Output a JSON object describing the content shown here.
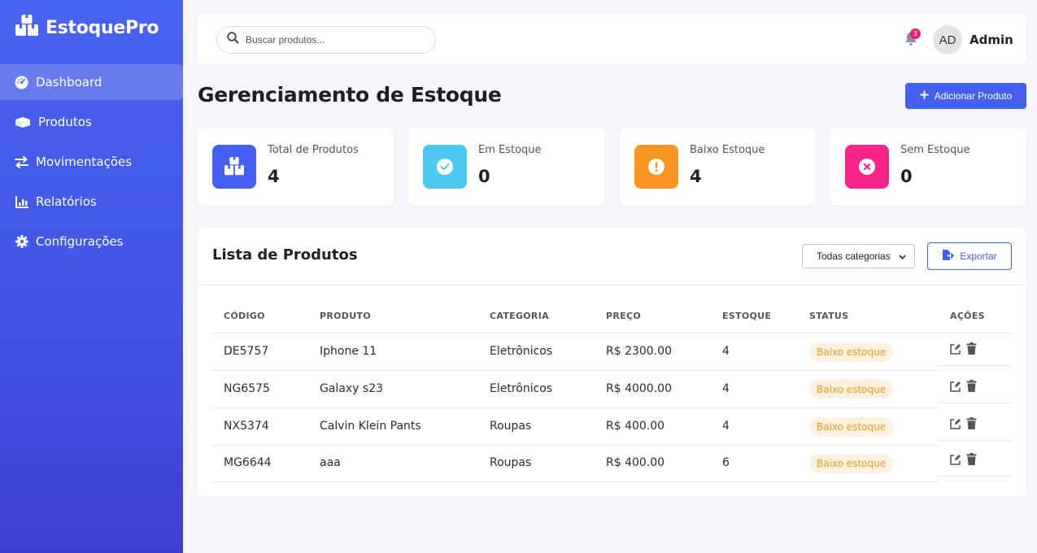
{
  "brand": {
    "name": "EstoquePro"
  },
  "sidebar": {
    "items": [
      {
        "label": "Dashboard",
        "icon": "dashboard-icon",
        "active": true
      },
      {
        "label": "Produtos",
        "icon": "boxes-icon"
      },
      {
        "label": "Movimentações",
        "icon": "exchange-icon"
      },
      {
        "label": "Relatórios",
        "icon": "chart-icon"
      },
      {
        "label": "Configurações",
        "icon": "gear-icon"
      }
    ]
  },
  "topbar": {
    "search_placeholder": "Buscar produtos...",
    "notification_count": "3",
    "avatar_initials": "AD",
    "user_name": "Admin"
  },
  "header": {
    "title": "Gerenciamento de Estoque",
    "add_button": "Adicionar Produto"
  },
  "cards": [
    {
      "label": "Total de Produtos",
      "value": "4",
      "color": "#4361ee",
      "icon": "boxes-icon"
    },
    {
      "label": "Em Estoque",
      "value": "0",
      "color": "#4cc9f0",
      "icon": "check-circle-icon"
    },
    {
      "label": "Baixo Estoque",
      "value": "4",
      "color": "#f8961e",
      "icon": "exclamation-circle-icon"
    },
    {
      "label": "Sem Estoque",
      "value": "0",
      "color": "#f72585",
      "icon": "times-circle-icon"
    }
  ],
  "product_list": {
    "title": "Lista de Produtos",
    "category_filter": "Todas categorias",
    "export_button": "Exportar",
    "columns": [
      "CÓDIGO",
      "PRODUTO",
      "CATEGORIA",
      "PREÇO",
      "ESTOQUE",
      "STATUS",
      "AÇÕES"
    ],
    "rows": [
      {
        "code": "DE5757",
        "product": "Iphone 11",
        "category": "Eletrônicos",
        "price": "R$ 2300.00",
        "stock": "4",
        "status": "Baixo estoque"
      },
      {
        "code": "NG6575",
        "product": "Galaxy s23",
        "category": "Eletrônicos",
        "price": "R$ 4000.00",
        "stock": "4",
        "status": "Baixo estoque"
      },
      {
        "code": "NX5374",
        "product": "Calvin Klein Pants",
        "category": "Roupas",
        "price": "R$ 400.00",
        "stock": "4",
        "status": "Baixo estoque"
      },
      {
        "code": "MG6644",
        "product": "aaa",
        "category": "Roupas",
        "price": "R$ 400.00",
        "stock": "6",
        "status": "Baixo estoque"
      }
    ]
  },
  "colors": {
    "accent": "#4361ee",
    "status_warning": "#f19a1a"
  }
}
